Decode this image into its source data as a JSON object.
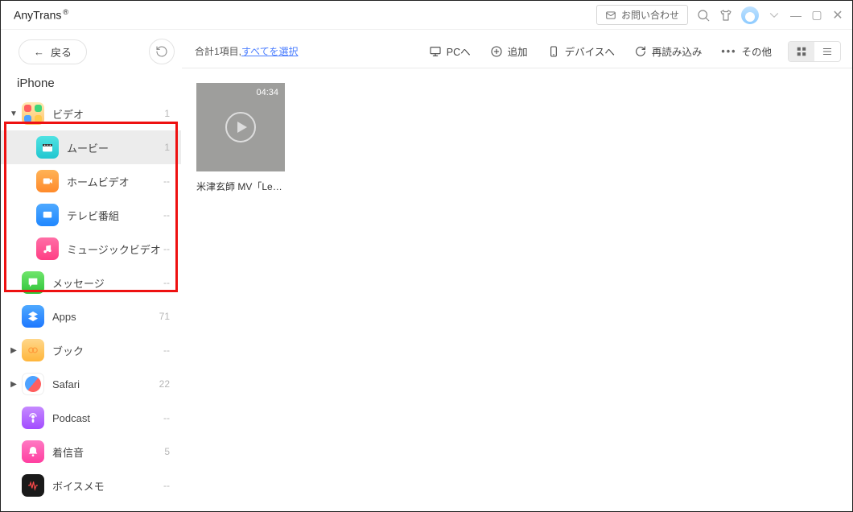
{
  "title": "AnyTrans",
  "titlebar": {
    "contact_label": "お問い合わせ"
  },
  "back_label": "戻る",
  "device_name": "iPhone",
  "sidebar": [
    {
      "key": "video",
      "label": "ビデオ",
      "count": "1",
      "icon": "bg-video",
      "chev": "▼",
      "sub": false
    },
    {
      "key": "movie",
      "label": "ムービー",
      "count": "1",
      "icon": "bg-movie",
      "chev": "",
      "sub": true,
      "selected": true
    },
    {
      "key": "home",
      "label": "ホームビデオ",
      "count": "--",
      "icon": "bg-home",
      "chev": "",
      "sub": true
    },
    {
      "key": "tv",
      "label": "テレビ番組",
      "count": "--",
      "icon": "bg-tv",
      "chev": "",
      "sub": true
    },
    {
      "key": "mv",
      "label": "ミュージックビデオ",
      "count": "--",
      "icon": "bg-mv",
      "chev": "",
      "sub": true
    },
    {
      "key": "msg",
      "label": "メッセージ",
      "count": "--",
      "icon": "bg-msg",
      "chev": "",
      "sub": false
    },
    {
      "key": "apps",
      "label": "Apps",
      "count": "71",
      "icon": "bg-apps",
      "chev": "",
      "sub": false
    },
    {
      "key": "book",
      "label": "ブック",
      "count": "--",
      "icon": "bg-book",
      "chev": "▶",
      "sub": false
    },
    {
      "key": "safari",
      "label": "Safari",
      "count": "22",
      "icon": "bg-safari",
      "chev": "▶",
      "sub": false
    },
    {
      "key": "podcast",
      "label": "Podcast",
      "count": "--",
      "icon": "bg-podcast",
      "chev": "",
      "sub": false
    },
    {
      "key": "ring",
      "label": "着信音",
      "count": "5",
      "icon": "bg-ring",
      "chev": "",
      "sub": false
    },
    {
      "key": "voice",
      "label": "ボイスメモ",
      "count": "--",
      "icon": "bg-voice",
      "chev": "",
      "sub": false
    }
  ],
  "toolbar": {
    "summary_prefix": "合計1項目,",
    "select_all": "すべてを選択",
    "to_pc": "PCへ",
    "add": "追加",
    "to_device": "デバイスへ",
    "reload": "再読み込み",
    "other": "その他"
  },
  "items": [
    {
      "duration": "04:34",
      "title": "米津玄師  MV「Lem..."
    }
  ]
}
